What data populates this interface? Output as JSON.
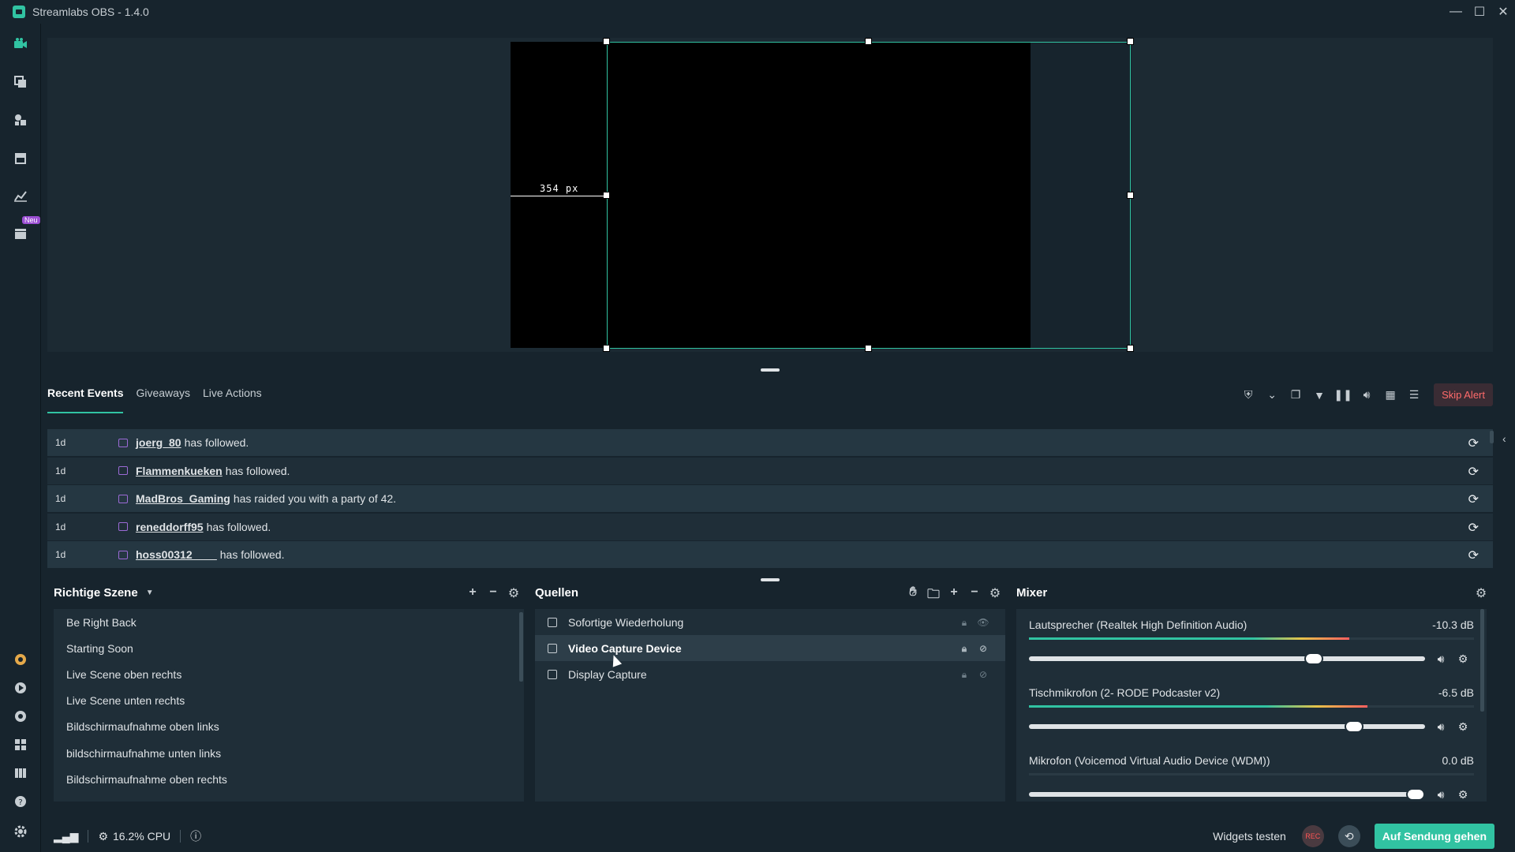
{
  "window": {
    "title": "Streamlabs OBS - 1.4.0",
    "minimize": "—",
    "maximize": "☐",
    "close": "✕"
  },
  "nav": {
    "badge_new": "Neu"
  },
  "preview": {
    "measure": "354 px"
  },
  "events": {
    "tabs": [
      "Recent Events",
      "Giveaways",
      "Live Actions"
    ],
    "skip_alert": "Skip Alert",
    "rows": [
      {
        "time": "1d",
        "user": "joerg_80",
        "text": "has followed."
      },
      {
        "time": "1d",
        "user": "Flammenkueken",
        "text": "has followed."
      },
      {
        "time": "1d",
        "user": "MadBros_Gaming",
        "text": "has raided you with a party of 42."
      },
      {
        "time": "1d",
        "user": "reneddorff95",
        "text": "has followed."
      },
      {
        "time": "1d",
        "user": "hoss00312____",
        "text": "has followed."
      }
    ]
  },
  "scenes": {
    "title": "Richtige Szene",
    "items": [
      "Be Right Back",
      "Starting Soon",
      "Live Scene oben rechts",
      "Live Scene unten rechts",
      "Bildschirmaufnahme oben links",
      "bildschirmaufnahme unten links",
      "Bildschirmaufnahme oben rechts"
    ]
  },
  "sources": {
    "title": "Quellen",
    "items": [
      "Sofortige Wiederholung",
      "Video Capture Device",
      "Display Capture"
    ],
    "selected_index": 1
  },
  "mixer": {
    "title": "Mixer",
    "channels": [
      {
        "name": "Lautsprecher (Realtek High Definition Audio)",
        "db": "-10.3 dB",
        "level": 0.72,
        "volume": 0.72
      },
      {
        "name": "Tischmikrofon (2- RODE Podcaster v2)",
        "db": "-6.5 dB",
        "level": 0.76,
        "volume": 0.82
      },
      {
        "name": "Mikrofon (Voicemod Virtual Audio Device (WDM))",
        "db": "0.0 dB",
        "level": 0,
        "volume": 1.0
      }
    ]
  },
  "footer": {
    "cpu": "16.2% CPU",
    "widgets_test": "Widgets testen",
    "rec": "REC",
    "go_live": "Auf Sendung gehen"
  },
  "colors": {
    "accent": "#31c3a2",
    "background": "#17242d",
    "panel": "#1f2e38"
  }
}
